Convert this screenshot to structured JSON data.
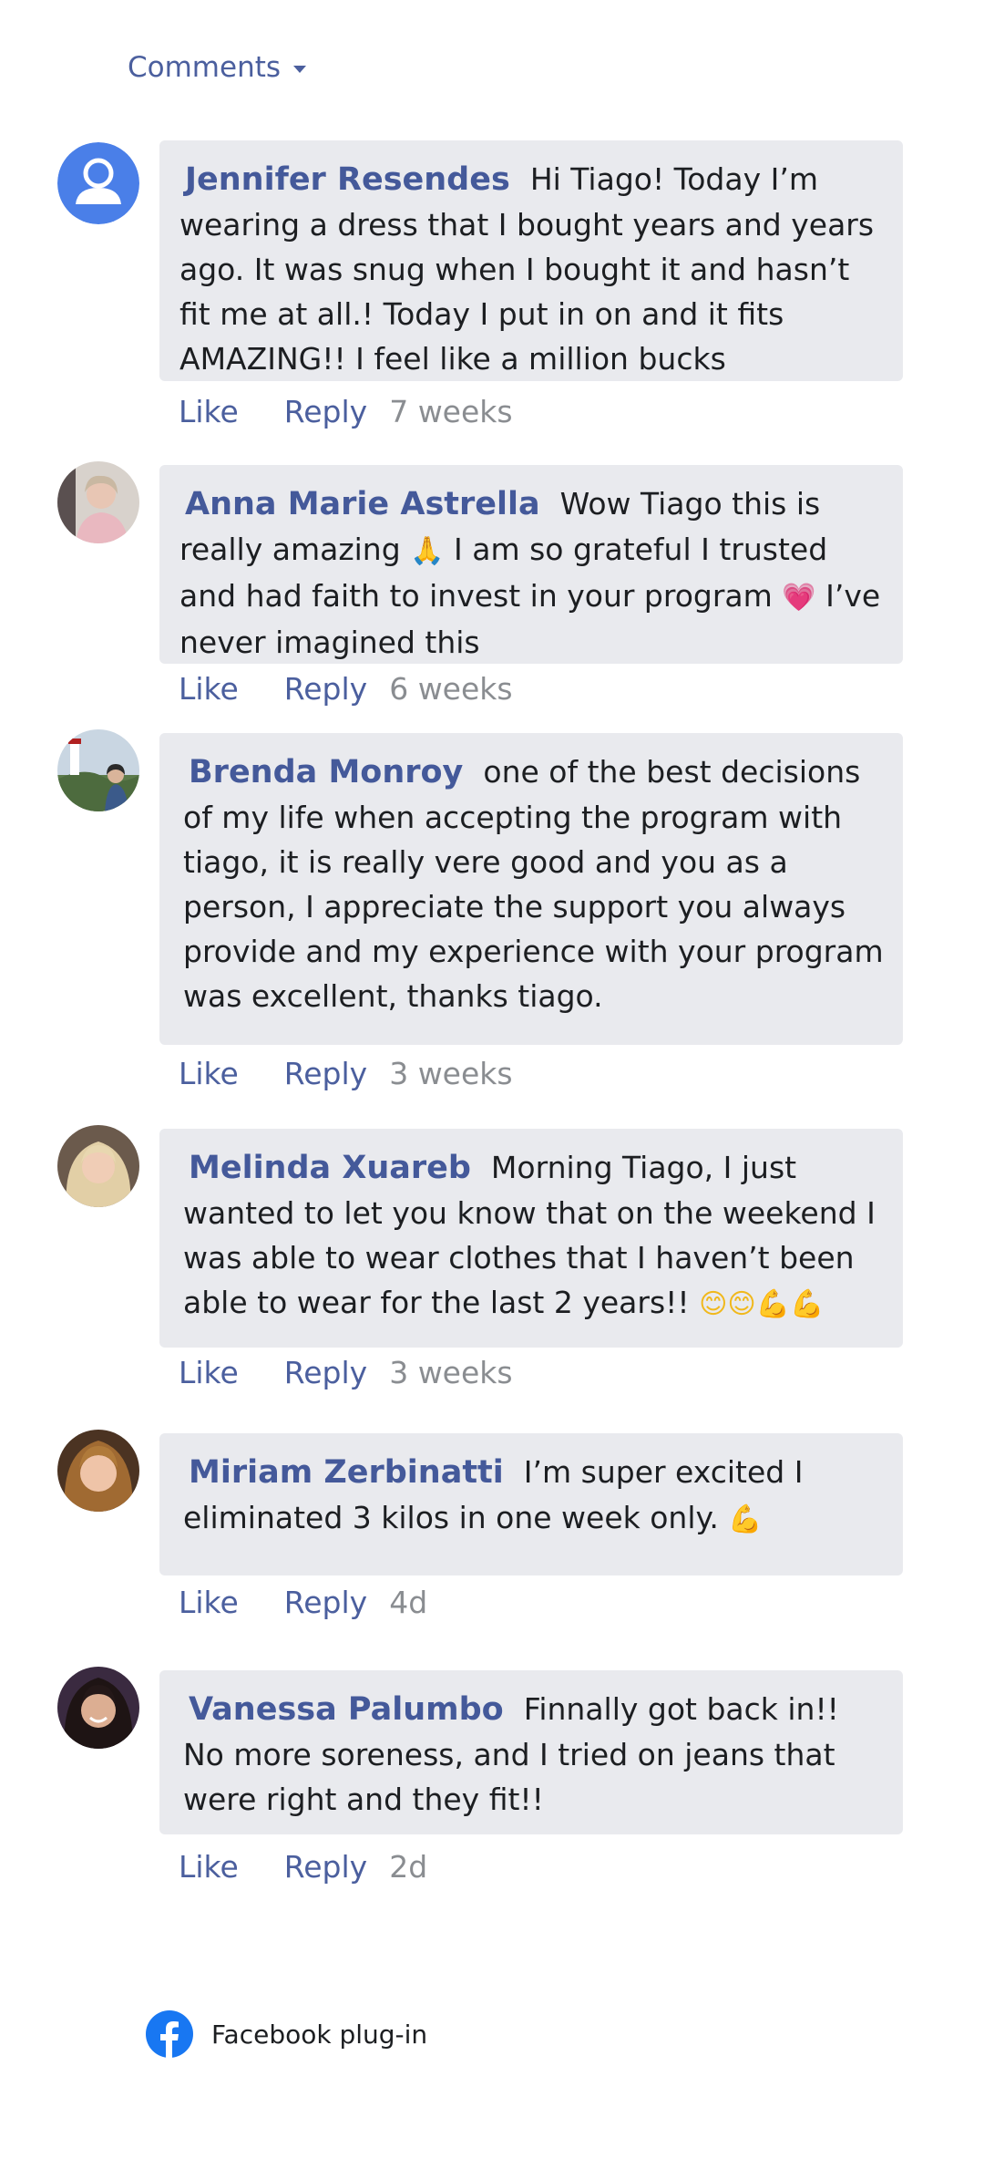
{
  "header": {
    "comments_label": "Comments"
  },
  "comments": [
    {
      "author": "Jennifer Resendes",
      "text": "Hi Tiago! Today I’m wearing a dress that I bought years and years ago. It was snug when I bought it and hasn’t fit me at all.! Today I put in on and it fits AMAZING!! I feel like a million bucks",
      "like": "Like",
      "reply": "Reply",
      "time": "7 weeks",
      "avatar": "default-user-avatar"
    },
    {
      "author": "Anna Marie Astrella",
      "text_parts": [
        "Wow Tiago this is really amazing ",
        " I am so grateful I trusted and had faith to invest in your program ",
        " I’ve never imagined this"
      ],
      "emoji_pray": "🙏",
      "emoji_heart": "💗",
      "like": "Like",
      "reply": "Reply",
      "time": "6 weeks",
      "avatar": "photo-avatar"
    },
    {
      "author": "Brenda Monroy",
      "text": "one of the best decisions of my life when accepting the program with tiago, it is really vere good and you as a person, I appreciate the support you always provide and my experience with your program was excellent, thanks tiago.",
      "like": "Like",
      "reply": "Reply",
      "time": "3 weeks",
      "avatar": "photo-avatar"
    },
    {
      "author": "Melinda Xuareb",
      "text": "Morning Tiago, I just wanted to let you know that on the weekend I was able to wear clothes that I haven’t been able to wear for the last 2 years!! ",
      "emojis": "😊😊💪💪",
      "like": "Like",
      "reply": "Reply",
      "time": "3 weeks",
      "avatar": "photo-avatar"
    },
    {
      "author": "Miriam Zerbinatti",
      "text": "I’m super excited I eliminated 3 kilos in one week only. ",
      "emojis": "💪",
      "like": "Like",
      "reply": "Reply",
      "time": "4d",
      "avatar": "photo-avatar"
    },
    {
      "author": "Vanessa Palumbo",
      "text": "Finnally got back in!! No more soreness, and I tried on jeans that were right and they fit!!",
      "like": "Like",
      "reply": "Reply",
      "time": "2d",
      "avatar": "photo-avatar"
    }
  ],
  "footer": {
    "label": "Facebook plug-in",
    "icon": "facebook-icon"
  },
  "colors": {
    "accent": "#4b5f9e",
    "bubble": "#e9eaee",
    "muted": "#8a8d91",
    "facebook_blue": "#1877f2"
  }
}
